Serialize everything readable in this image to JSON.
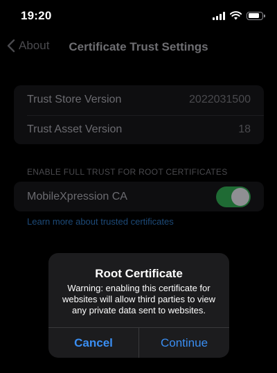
{
  "status_bar": {
    "time": "19:20"
  },
  "nav": {
    "back_label": "About",
    "title": "Certificate Trust Settings"
  },
  "info": {
    "rows": [
      {
        "label": "Trust Store Version",
        "value": "2022031500"
      },
      {
        "label": "Trust Asset Version",
        "value": "18"
      }
    ]
  },
  "trust_section": {
    "header": "ENABLE FULL TRUST FOR ROOT CERTIFICATES",
    "certificate_name": "MobileXpression CA",
    "enabled": true,
    "learn_more": "Learn more about trusted certificates"
  },
  "alert": {
    "title": "Root Certificate",
    "message": "Warning: enabling this certificate for websites will allow third parties to view any private data sent to websites.",
    "cancel_label": "Cancel",
    "continue_label": "Continue"
  },
  "colors": {
    "toggle_on": "#1f6b34",
    "link": "#3a8ef2"
  },
  "icons": {
    "back": "chevron-left-icon",
    "signal": "cellular-signal-icon",
    "wifi": "wifi-icon",
    "battery": "battery-icon"
  }
}
